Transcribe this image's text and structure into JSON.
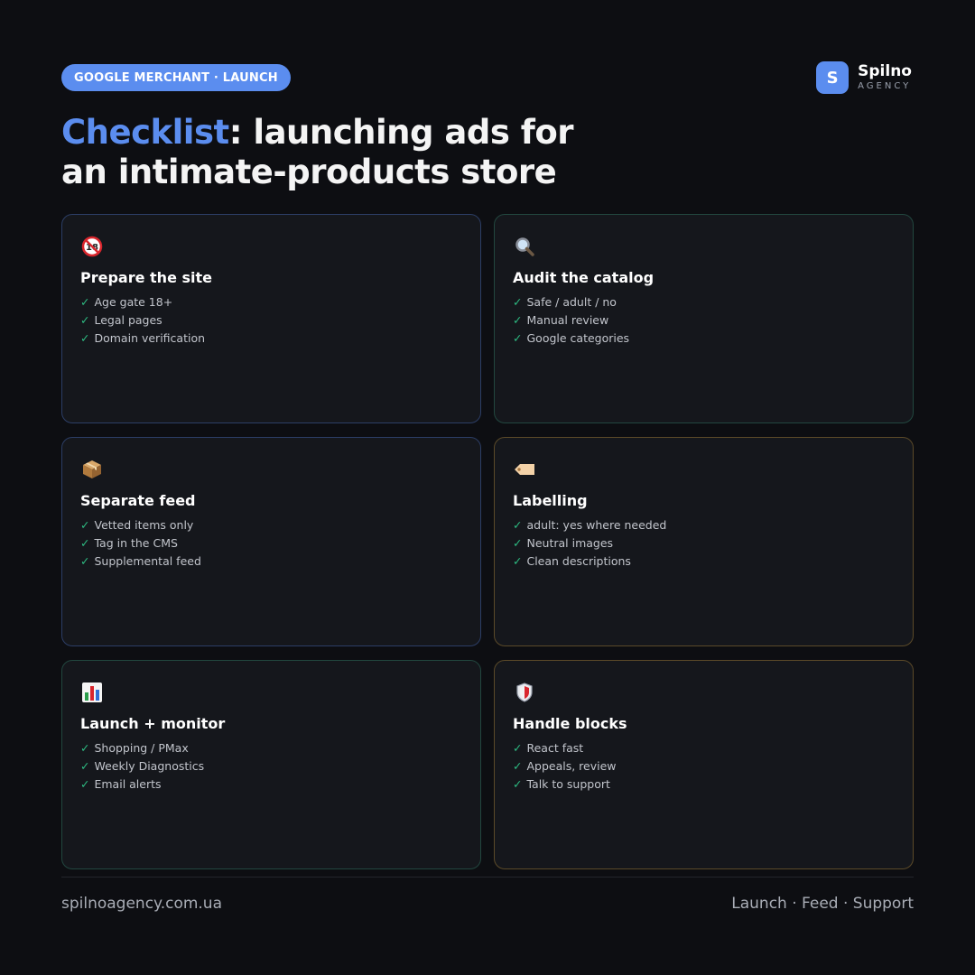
{
  "header": {
    "pill_label": "GOOGLE MERCHANT · LAUNCH",
    "brand_logo_letter": "S",
    "brand_name": "Spilno",
    "brand_sub": "AGENCY",
    "title_accent": "Checklist",
    "title_rest": ": launching ads for",
    "title_line2": "an intimate-products store"
  },
  "cards": [
    {
      "icon": "no-under-18-icon",
      "title": "Prepare the site",
      "items": [
        "Age gate 18+",
        "Legal pages",
        "Domain verification"
      ],
      "border_color": "#2c3e66"
    },
    {
      "icon": "magnifier-icon",
      "title": "Audit the catalog",
      "items": [
        "Safe / adult / no",
        "Manual review",
        "Google categories"
      ],
      "border_color": "#22473f"
    },
    {
      "icon": "package-icon",
      "title": "Separate feed",
      "items": [
        "Vetted items only",
        "Tag in the CMS",
        "Supplemental feed"
      ],
      "border_color": "#2c3e66"
    },
    {
      "icon": "label-tag-icon",
      "title": "Labelling",
      "items": [
        "adult: yes where needed",
        "Neutral images",
        "Clean descriptions"
      ],
      "border_color": "#5b4a29"
    },
    {
      "icon": "bar-chart-icon",
      "title": "Launch + monitor",
      "items": [
        "Shopping / PMax",
        "Weekly Diagnostics",
        "Email alerts"
      ],
      "border_color": "#22473f"
    },
    {
      "icon": "shield-icon",
      "title": "Handle blocks",
      "items": [
        "React fast",
        "Appeals, review",
        "Talk to support"
      ],
      "border_color": "#5b4a29"
    }
  ],
  "check_mark": "✓",
  "footer": {
    "website": "spilnoagency.com.ua",
    "tagline": "Launch · Feed · Support"
  },
  "colors": {
    "accent": "#5b8def",
    "check": "#2ebd83",
    "background": "#0d0e12",
    "card_bg": "#15171c"
  }
}
